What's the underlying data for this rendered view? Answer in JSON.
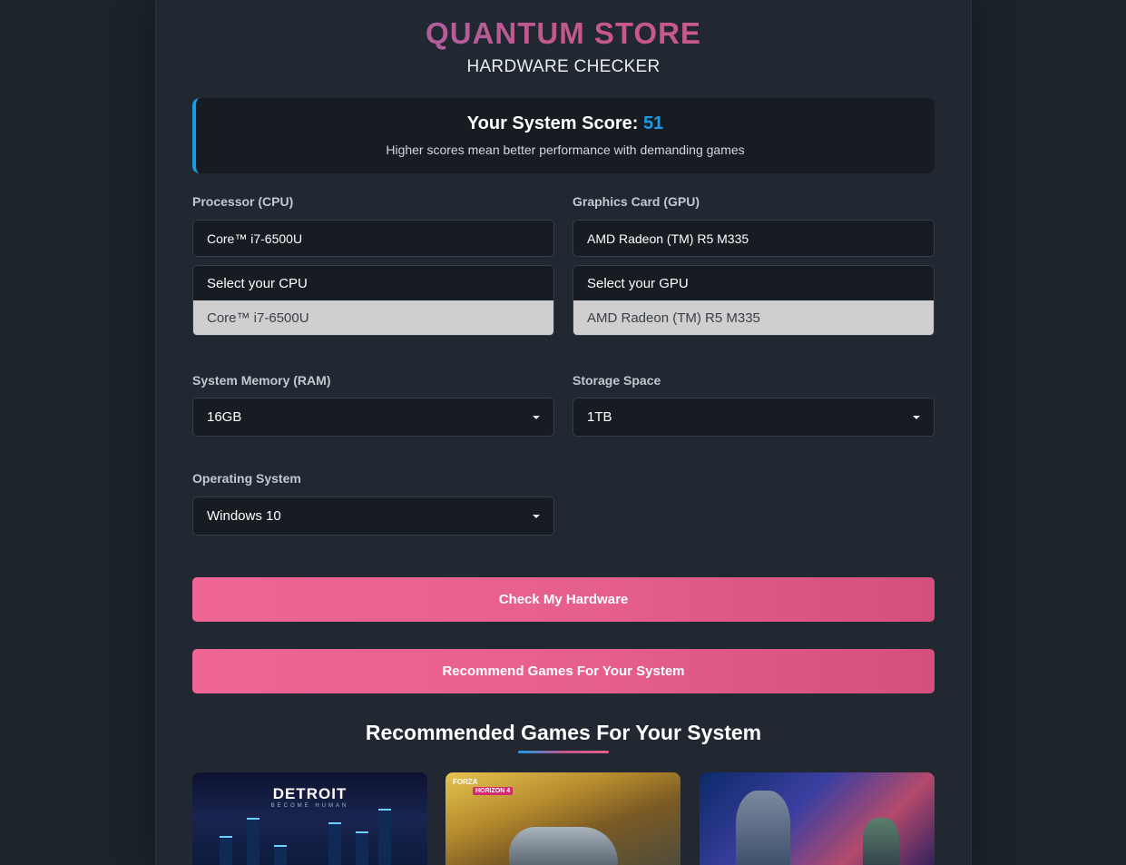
{
  "header": {
    "brand": "QUANTUM STORE",
    "subtitle": "HARDWARE CHECKER"
  },
  "score": {
    "label": "Your System Score: ",
    "value": "51",
    "hint": "Higher scores mean better performance with demanding games"
  },
  "cpu": {
    "label": "Processor (CPU)",
    "search_value": "Core™ i7-6500U",
    "select_placeholder": "Select your CPU",
    "selected_option": "Core™ i7-6500U"
  },
  "gpu": {
    "label": "Graphics Card (GPU)",
    "search_value": "AMD Radeon (TM) R5 M335",
    "select_placeholder": "Select your GPU",
    "selected_option": "AMD Radeon (TM) R5 M335"
  },
  "ram": {
    "label": "System Memory (RAM)",
    "value": "16GB"
  },
  "storage": {
    "label": "Storage Space",
    "value": "1TB"
  },
  "os": {
    "label": "Operating System",
    "value": "Windows 10"
  },
  "buttons": {
    "check": "Check My Hardware",
    "recommend": "Recommend Games For Your System"
  },
  "recommended": {
    "title": "Recommended Games For Your System",
    "games": [
      {
        "logo": "DETROIT",
        "logo_sub": "BECOME HUMAN"
      },
      {
        "logo": "FORZA",
        "logo_sub": "HORIZON 4"
      },
      {
        "logo": ""
      }
    ]
  },
  "colors": {
    "accent_blue": "#1a9be6",
    "button_pink": "#e65f8b",
    "background": "#1c232b",
    "panel": "#212832"
  }
}
